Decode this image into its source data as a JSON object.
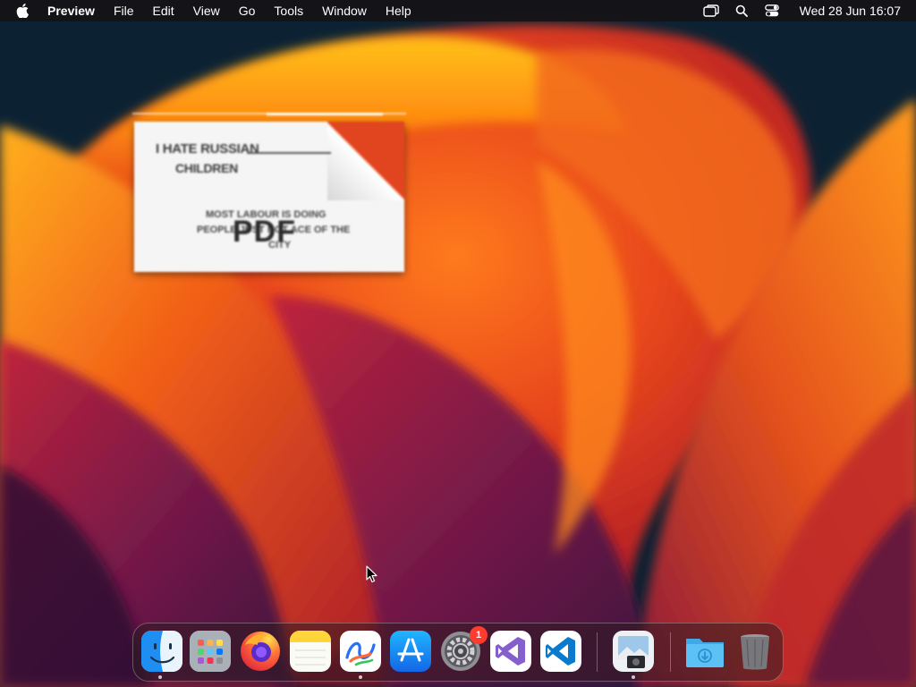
{
  "menubar": {
    "apple_icon": "apple-logo-icon",
    "app_name": "Preview",
    "menus": [
      "File",
      "Edit",
      "View",
      "Go",
      "Tools",
      "Window",
      "Help"
    ],
    "status_icons": [
      "screen-mirroring-icon",
      "spotlight-search-icon",
      "control-center-icon"
    ],
    "clock": "Wed 28 Jun  16:07"
  },
  "desktop": {
    "wallpaper": "macos-ventura-orange-wallpaper",
    "preview_window": {
      "text_line_1": "I HATE RUSSIAN",
      "text_line_2": "CHILDREN",
      "text_small_1": "MOST LABOUR IS DOING",
      "text_small_2": "PEOPLE JUST NOT ACE OF THE",
      "text_small_3": "CITY",
      "pdf_label": "PDF"
    }
  },
  "dock": {
    "apps": [
      {
        "name": "Finder",
        "icon": "finder-icon",
        "running": true
      },
      {
        "name": "Launchpad",
        "icon": "launchpad-icon",
        "running": false
      },
      {
        "name": "Firefox",
        "icon": "firefox-icon",
        "running": false
      },
      {
        "name": "Notes",
        "icon": "notes-icon",
        "running": false
      },
      {
        "name": "Freeform",
        "icon": "freeform-icon",
        "running": true
      },
      {
        "name": "App Store",
        "icon": "app-store-icon",
        "running": false
      },
      {
        "name": "System Settings",
        "icon": "system-settings-icon",
        "running": false,
        "badge": "1"
      },
      {
        "name": "Visual Studio",
        "icon": "visual-studio-icon",
        "running": false
      },
      {
        "name": "Visual Studio Code",
        "icon": "vscode-icon",
        "running": false
      },
      {
        "name": "Preview",
        "icon": "preview-icon",
        "running": true
      },
      {
        "name": "Downloads",
        "icon": "downloads-folder-icon",
        "running": false
      },
      {
        "name": "Trash",
        "icon": "trash-icon",
        "running": false
      }
    ],
    "colors": {
      "firefox": "#ff7139",
      "app_store": "#1c8ef6",
      "visual_studio": "#865fcf",
      "vscode": "#0a7acc",
      "downloads": "#4fc3f7",
      "badge": "#ff3b30"
    }
  }
}
